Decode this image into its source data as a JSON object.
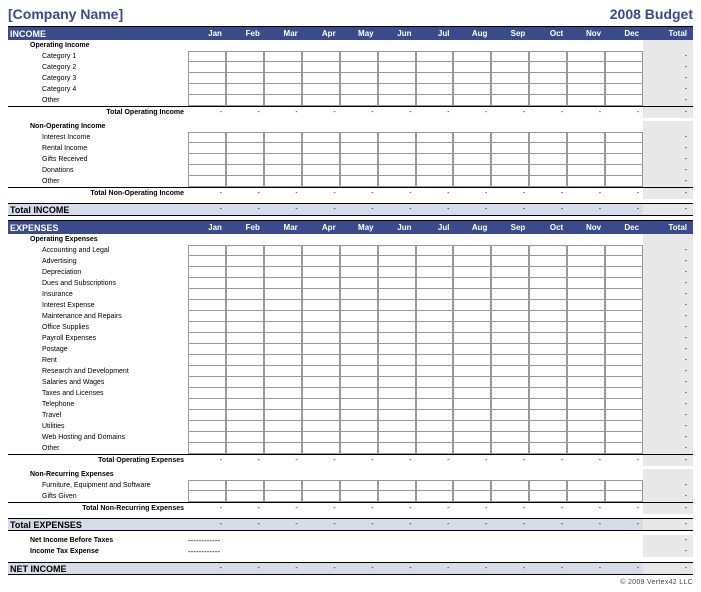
{
  "header": {
    "company_name": "[Company Name]",
    "budget_title": "2008 Budget"
  },
  "months": [
    "Jan",
    "Feb",
    "Mar",
    "Apr",
    "May",
    "Jun",
    "Jul",
    "Aug",
    "Sep",
    "Oct",
    "Nov",
    "Dec"
  ],
  "total_label": "Total",
  "dash": "-",
  "sections": {
    "income": {
      "title": "INCOME",
      "operating": {
        "group": "Operating Income",
        "items": [
          "Category 1",
          "Category 2",
          "Category 3",
          "Category 4",
          "Other"
        ],
        "total_label": "Total Operating Income"
      },
      "nonoperating": {
        "group": "Non-Operating Income",
        "items": [
          "Interest Income",
          "Rental Income",
          "Gifts Received",
          "Donations",
          "Other"
        ],
        "total_label": "Total Non-Operating Income"
      },
      "grand_total": "Total INCOME"
    },
    "expenses": {
      "title": "EXPENSES",
      "operating": {
        "group": "Operating Expenses",
        "items": [
          "Accounting and Legal",
          "Advertising",
          "Depreciation",
          "Dues and Subscriptions",
          "Insurance",
          "Interest Expense",
          "Maintenance and Repairs",
          "Office Supplies",
          "Payroll Expenses",
          "Postage",
          "Rent",
          "Research and Development",
          "Salaries and Wages",
          "Taxes and Licenses",
          "Telephone",
          "Travel",
          "Utilities",
          "Web Hosting and Domains",
          "Other"
        ],
        "total_label": "Total Operating Expenses"
      },
      "nonrecurring": {
        "group": "Non-Recurring Expenses",
        "items": [
          "Furniture, Equipment and Software",
          "Gifts Given"
        ],
        "total_label": "Total Non-Recurring Expenses"
      },
      "grand_total": "Total EXPENSES"
    },
    "footer_rows": {
      "before_tax": "Net Income Before Taxes",
      "tax": "Income Tax Expense"
    },
    "net_income": "NET INCOME"
  },
  "footnote": "© 2009 Vertex42 LLC"
}
